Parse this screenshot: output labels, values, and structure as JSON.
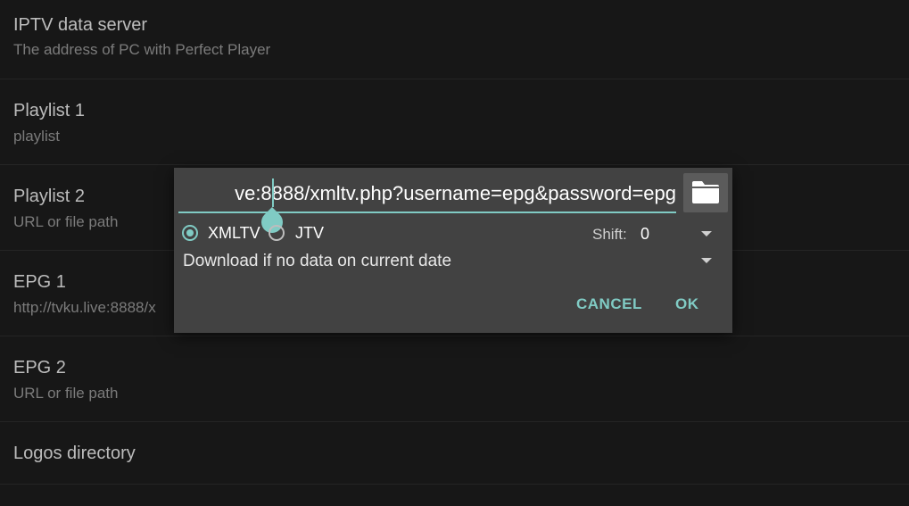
{
  "settings": {
    "rows": [
      {
        "title": "IPTV data server",
        "subtitle": "The address of PC with Perfect Player"
      },
      {
        "title": "Playlist 1",
        "subtitle": "playlist"
      },
      {
        "title": "Playlist 2",
        "subtitle": "URL or file path"
      },
      {
        "title": "EPG 1",
        "subtitle": "http://tvku.live:8888/x"
      },
      {
        "title": "EPG 2",
        "subtitle": "URL or file path"
      },
      {
        "title": "Logos directory",
        "subtitle": ""
      }
    ]
  },
  "dialog": {
    "url_value": "ve:8888/xmltv.php?username=epg&password=epg",
    "folder_icon": "folder-icon",
    "format_options": [
      {
        "label": "XMLTV",
        "selected": true
      },
      {
        "label": "JTV",
        "selected": false
      }
    ],
    "shift_label": "Shift:",
    "shift_value": "0",
    "download_mode": "Download if no data on current date",
    "cancel_label": "CANCEL",
    "ok_label": "OK"
  },
  "colors": {
    "accent": "#80cbc4",
    "background": "#1b1b1b",
    "dialog": "#424242"
  }
}
